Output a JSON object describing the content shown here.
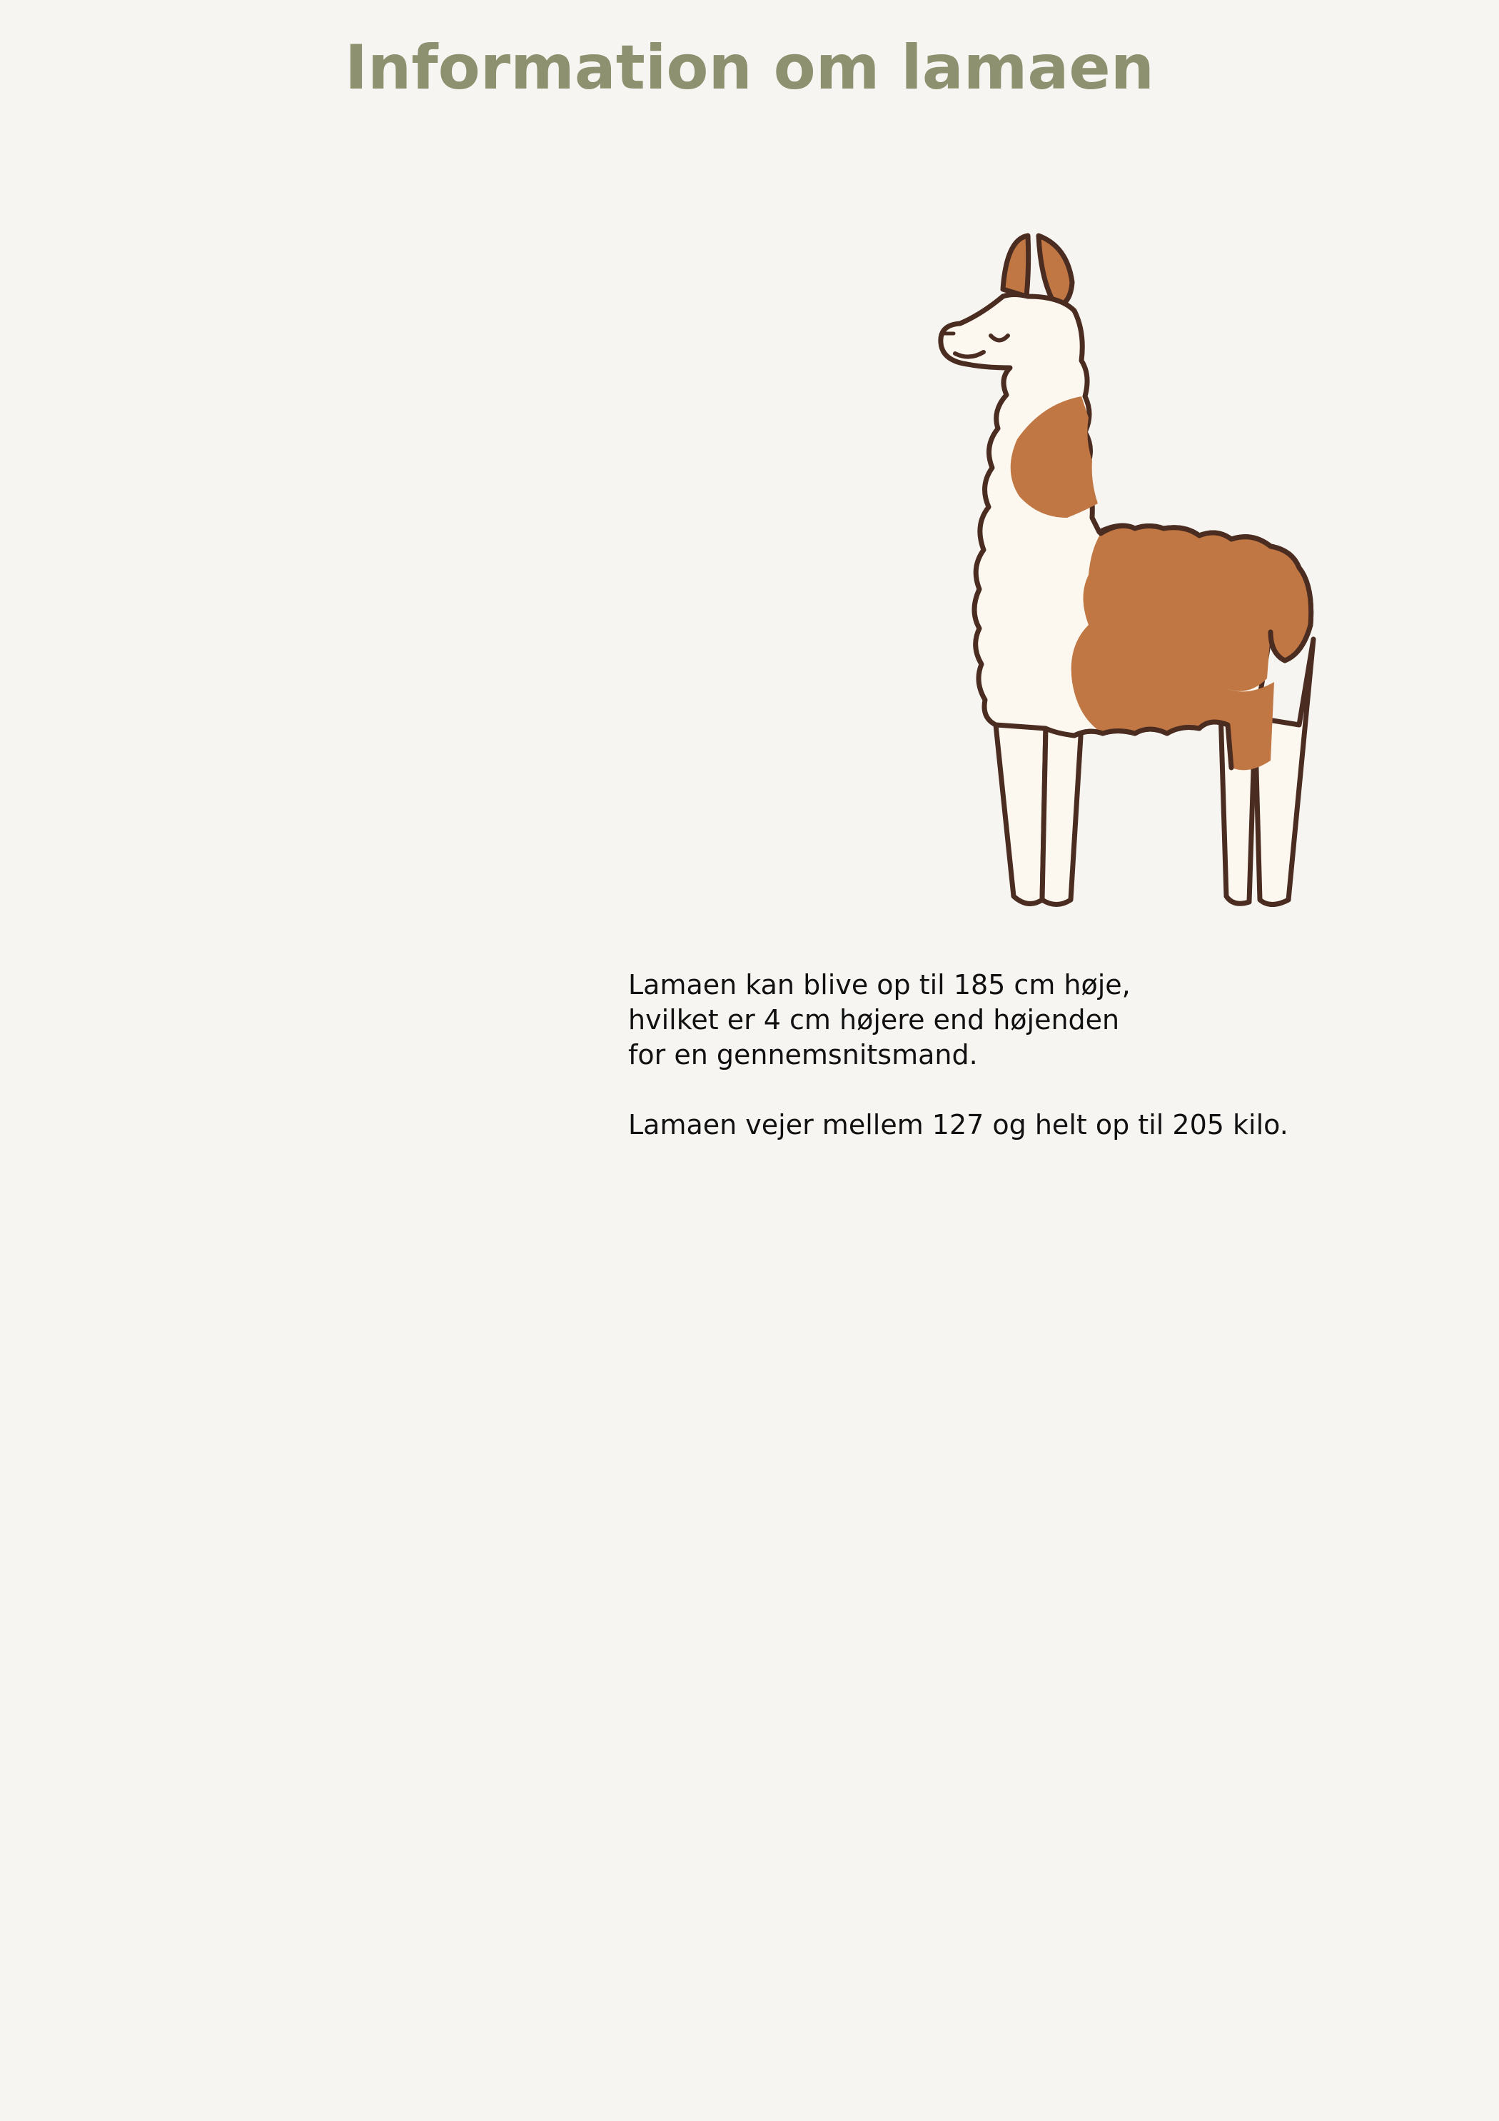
{
  "title": "Information om lamaen",
  "illustration": {
    "icon": "llama-icon",
    "colors": {
      "outline": "#4a2c21",
      "body": "#fcf8f0",
      "fur": "#c07743"
    }
  },
  "facts": {
    "height_line1": "Lamaen kan blive op til 185 cm høje,",
    "height_line2": "hvilket er 4 cm højere end højenden",
    "height_line3": "for en gennemsnitsmand.",
    "weight": "Lamaen vejer mellem 127 og helt op til 205 kilo."
  },
  "colors": {
    "background": "#f6f5f1",
    "title": "#8d9170",
    "text": "#111111"
  }
}
